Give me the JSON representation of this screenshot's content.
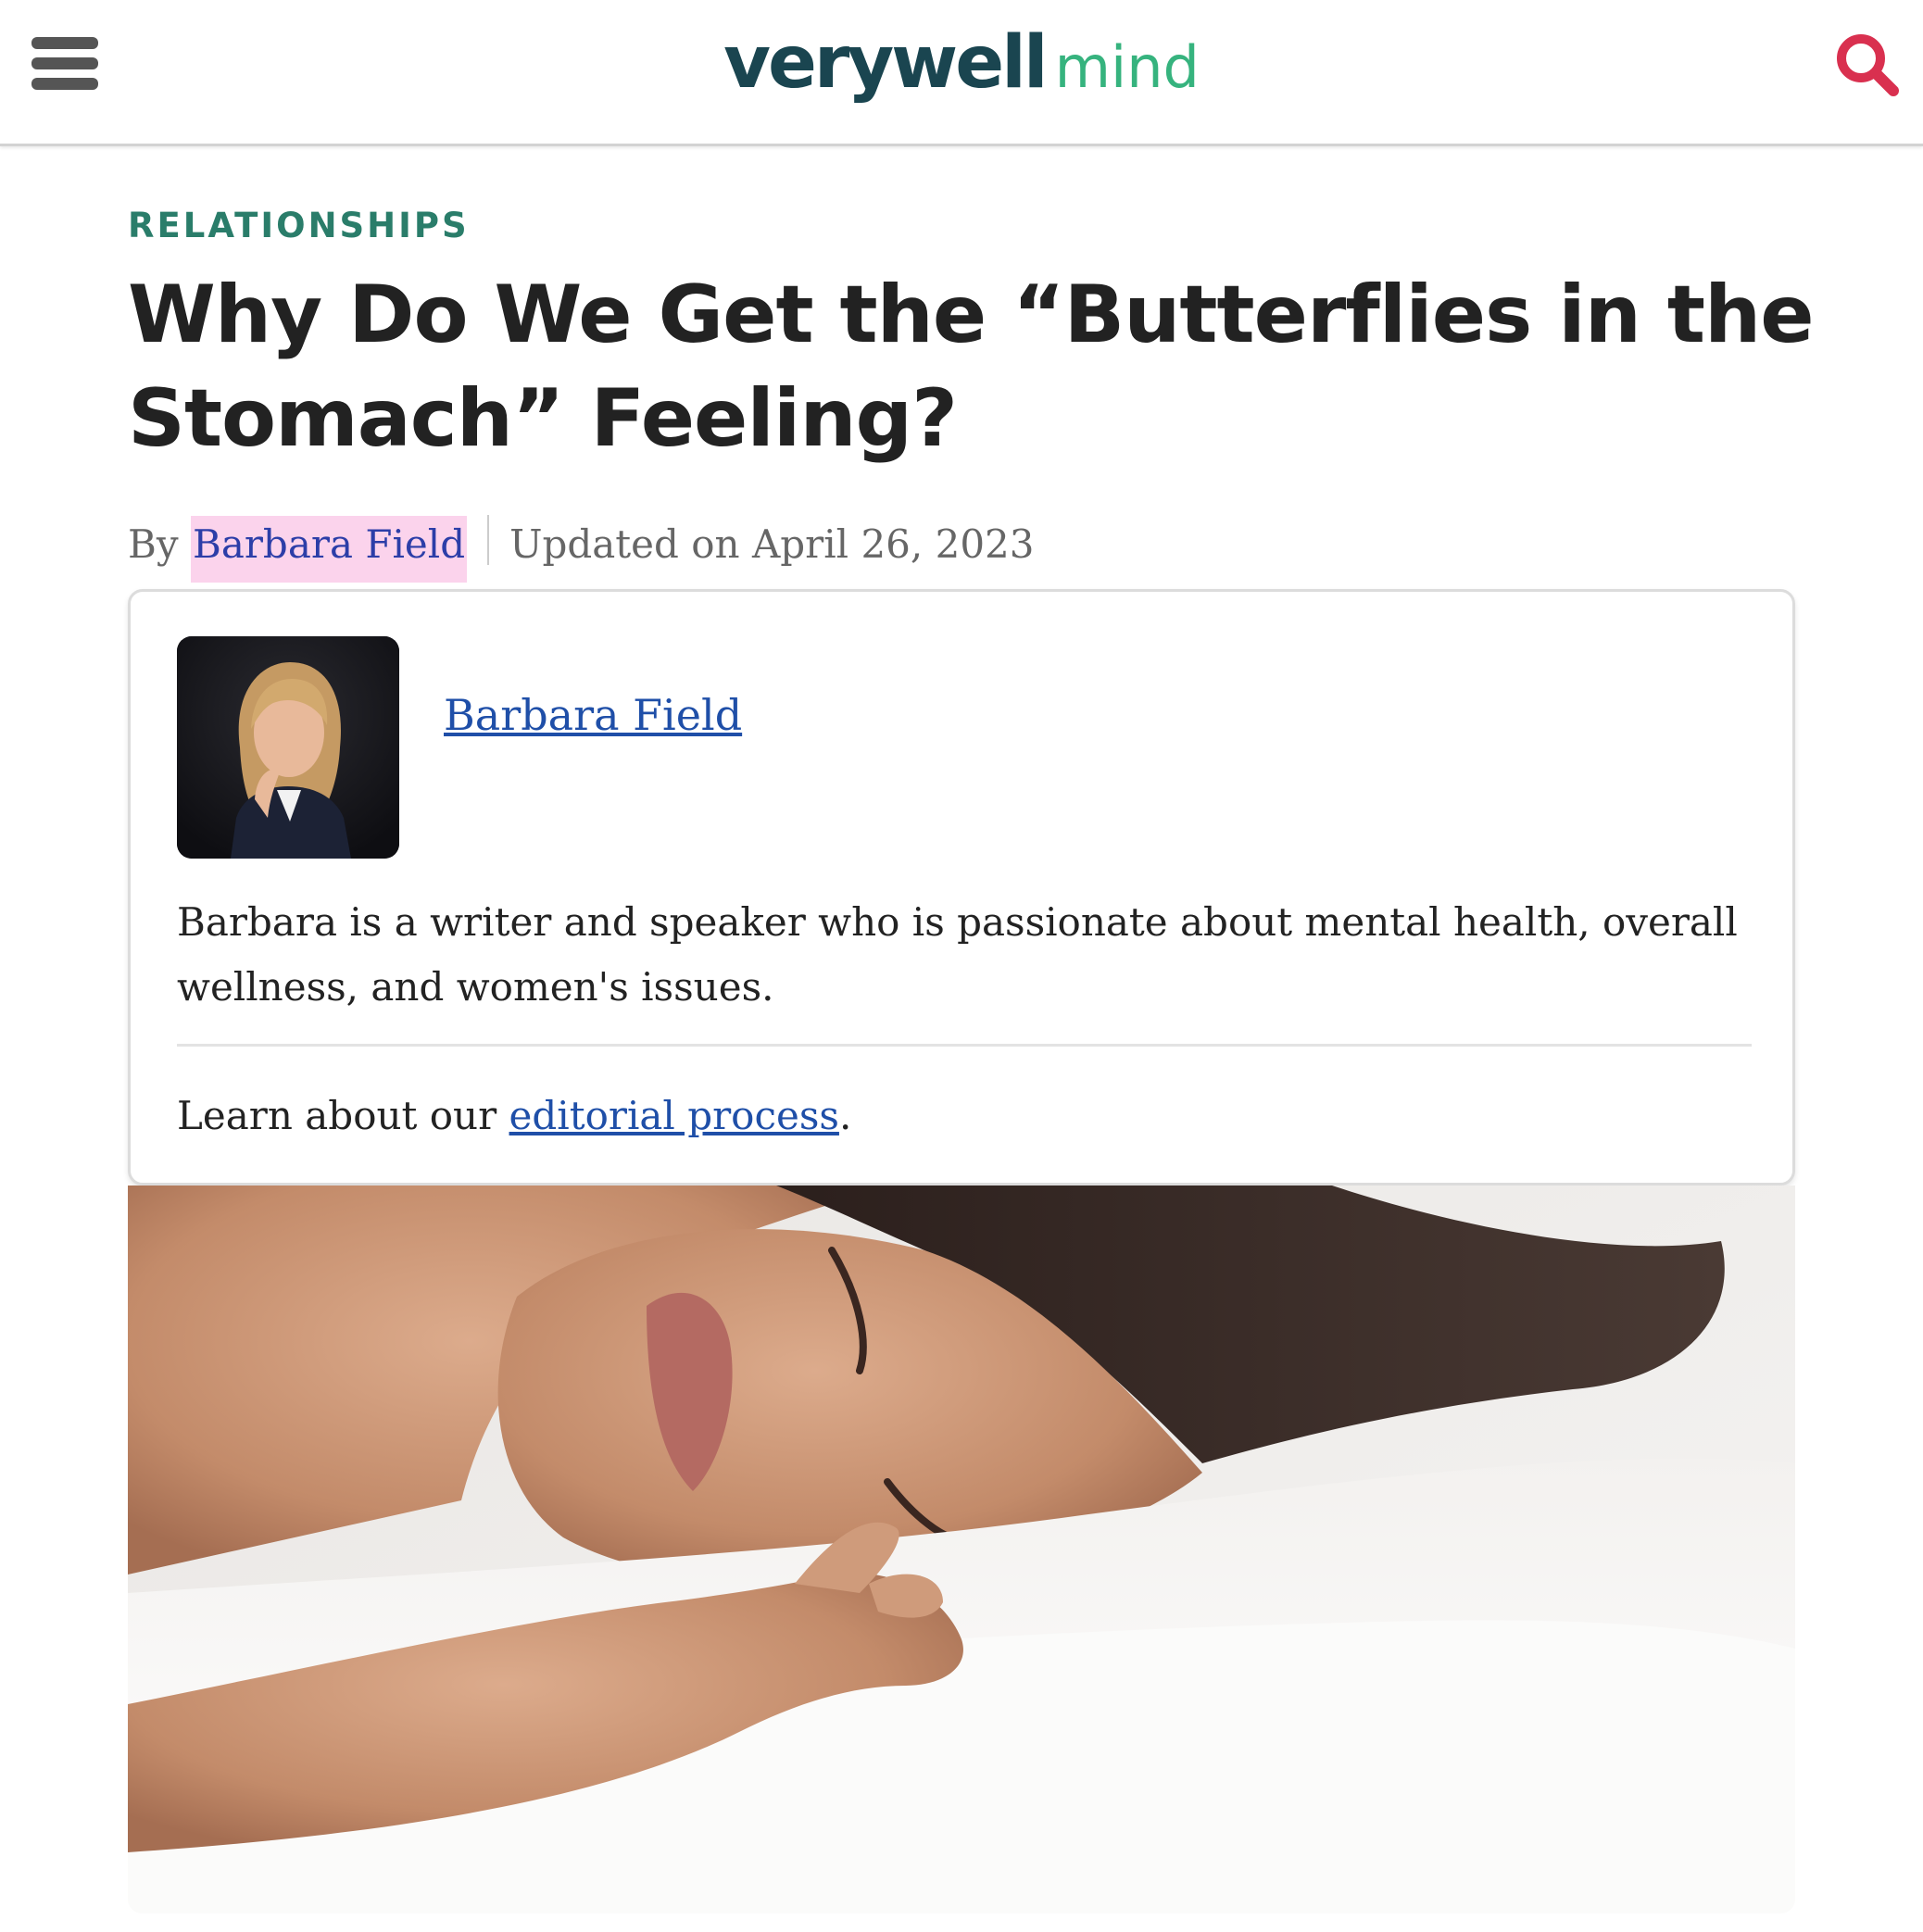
{
  "header": {
    "logo_primary": "verywell",
    "logo_secondary": "mind",
    "logo_primary_color": "#1a4550",
    "logo_secondary_color": "#36b37e",
    "menu_icon": "hamburger-menu-icon",
    "search_icon": "search-icon",
    "search_icon_color": "#d9304f"
  },
  "article": {
    "category": "RELATIONSHIPS",
    "title": "Why Do We Get the “Butterflies in the Stomach” Feeling?",
    "byline_prefix": "By",
    "author": "Barbara Field",
    "updated": "Updated on April 26, 2023"
  },
  "author_card": {
    "name": "Barbara Field",
    "bio": "Barbara is a writer and speaker who is passionate about mental health, overall wellness, and women's issues.",
    "editorial_prefix": "Learn about our",
    "editorial_link": "editorial process",
    "editorial_suffix": "."
  },
  "colors": {
    "category": "#2a7d6a",
    "link": "#1f4fa8",
    "author_highlight": "#fbd3ec"
  }
}
